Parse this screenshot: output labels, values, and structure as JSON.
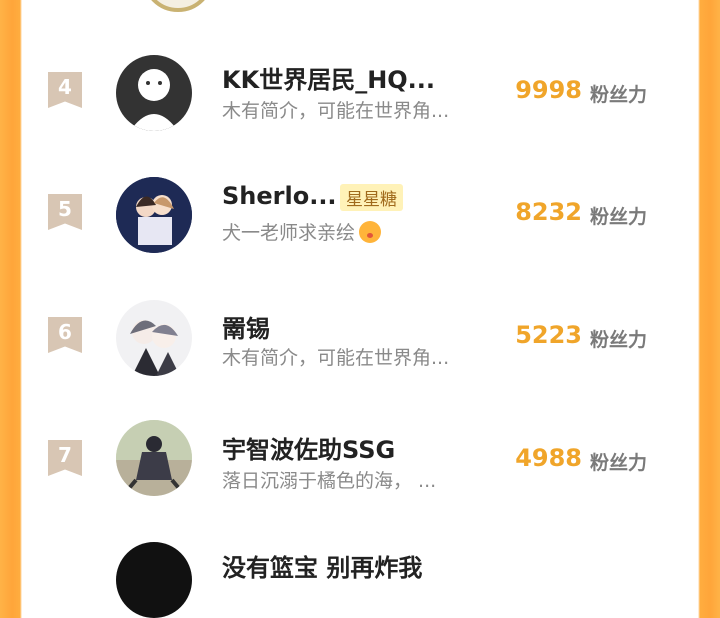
{
  "rows": [
    {
      "rank": "4",
      "name": "KK世界居民_HQ...",
      "badge": "",
      "bio": "木有简介，可能在世界角...",
      "score": "9998",
      "unit": "粉丝力",
      "avatar_icon": "default-user-icon"
    },
    {
      "rank": "5",
      "name": "Sherlo...",
      "badge": "星星糖",
      "bio": "犬一老师求亲绘",
      "score": "8232",
      "unit": "粉丝力",
      "avatar_icon": "anime-couple-avatar"
    },
    {
      "rank": "6",
      "name": "罱锡",
      "badge": "",
      "bio": "木有简介，可能在世界角...",
      "score": "5223",
      "unit": "粉丝力",
      "avatar_icon": "anime-boys-avatar"
    },
    {
      "rank": "7",
      "name": "宇智波佐助SSG",
      "badge": "",
      "bio": "落日沉溺于橘色的海，  ...",
      "score": "4988",
      "unit": "粉丝力",
      "avatar_icon": "ninja-avatar"
    }
  ],
  "partial_bottom_name": "没有篮宝 别再炸我"
}
